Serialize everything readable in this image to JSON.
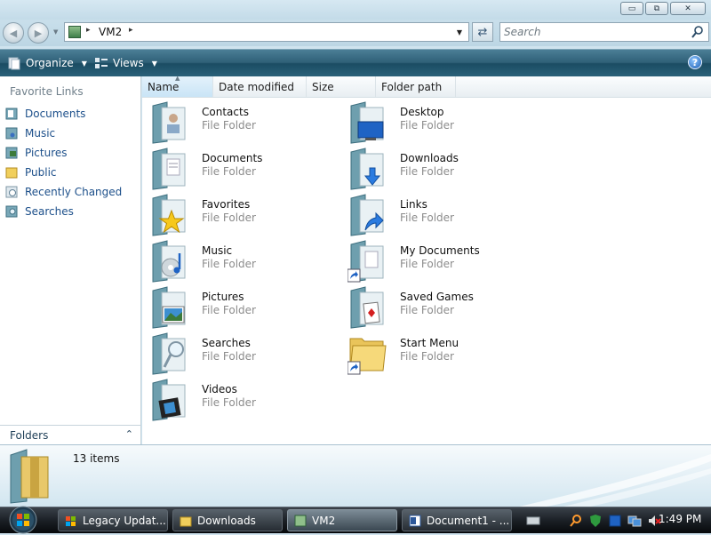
{
  "titlebar": {
    "minimize_glyph": "▭",
    "maximize_glyph": "⧉",
    "close_glyph": "✕"
  },
  "address": {
    "crumb": "VM2",
    "sep": "▸",
    "drop": "▼"
  },
  "search": {
    "placeholder": "Search"
  },
  "toolbar": {
    "organize_label": "Organize",
    "views_label": "Views",
    "help_glyph": "?"
  },
  "sidebar": {
    "header": "Favorite Links",
    "items": [
      {
        "label": "Documents",
        "icon": "documents-icon"
      },
      {
        "label": "Music",
        "icon": "music-icon"
      },
      {
        "label": "Pictures",
        "icon": "pictures-icon"
      },
      {
        "label": "Public",
        "icon": "public-folder-icon"
      },
      {
        "label": "Recently Changed",
        "icon": "recently-changed-icon"
      },
      {
        "label": "Searches",
        "icon": "searches-icon"
      }
    ],
    "folders_label": "Folders",
    "folders_chevron": "⌃"
  },
  "columns": [
    "Name",
    "Date modified",
    "Size",
    "Folder path"
  ],
  "files": [
    {
      "name": "Contacts",
      "type": "File Folder",
      "icon": "contacts-folder-icon"
    },
    {
      "name": "Desktop",
      "type": "File Folder",
      "icon": "desktop-folder-icon"
    },
    {
      "name": "Documents",
      "type": "File Folder",
      "icon": "documents-folder-icon"
    },
    {
      "name": "Downloads",
      "type": "File Folder",
      "icon": "downloads-folder-icon"
    },
    {
      "name": "Favorites",
      "type": "File Folder",
      "icon": "favorites-folder-icon"
    },
    {
      "name": "Links",
      "type": "File Folder",
      "icon": "links-folder-icon"
    },
    {
      "name": "Music",
      "type": "File Folder",
      "icon": "music-folder-icon"
    },
    {
      "name": "My Documents",
      "type": "File Folder",
      "icon": "my-documents-shortcut-icon"
    },
    {
      "name": "Pictures",
      "type": "File Folder",
      "icon": "pictures-folder-icon"
    },
    {
      "name": "Saved Games",
      "type": "File Folder",
      "icon": "saved-games-folder-icon"
    },
    {
      "name": "Searches",
      "type": "File Folder",
      "icon": "searches-folder-icon"
    },
    {
      "name": "Start Menu",
      "type": "File Folder",
      "icon": "start-menu-shortcut-icon"
    },
    {
      "name": "Videos",
      "type": "File Folder",
      "icon": "videos-folder-icon"
    }
  ],
  "details": {
    "count_text": "13 items"
  },
  "taskbar": {
    "tasks": [
      {
        "label": "Legacy Updat...",
        "icon": "legacy-update-icon"
      },
      {
        "label": "Downloads",
        "icon": "folder-icon"
      },
      {
        "label": "VM2",
        "icon": "computer-icon"
      },
      {
        "label": "Document1 - ...",
        "icon": "word-document-icon"
      }
    ],
    "clock": "1:49 PM"
  },
  "colors": {
    "accent": "#2f6077",
    "link": "#1c4f8a",
    "secondary_text": "#8c8c8c"
  }
}
